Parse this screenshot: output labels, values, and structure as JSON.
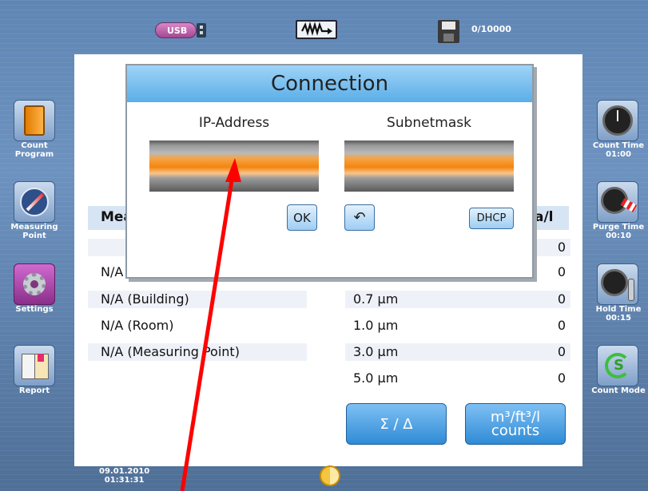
{
  "top_bar": {
    "usb_label": "USB",
    "memory_count": "0/10000"
  },
  "left_sidebar": [
    {
      "label_line1": "Count",
      "label_line2": "Program",
      "icon": "book-icon"
    },
    {
      "label_line1": "Measuring",
      "label_line2": "Point",
      "icon": "compass-icon"
    },
    {
      "label_line1": "Settings",
      "label_line2": "",
      "icon": "gear-icon"
    },
    {
      "label_line1": "Report",
      "label_line2": "",
      "icon": "report-icon"
    }
  ],
  "right_sidebar": [
    {
      "label": "Count Time",
      "value": "01:00",
      "icon": "clock-icon"
    },
    {
      "label": "Purge Time",
      "value": "00:10",
      "icon": "windsock-clock-icon"
    },
    {
      "label": "Hold Time",
      "value": "00:15",
      "icon": "thermometer-clock-icon"
    },
    {
      "label": "Count Mode",
      "value": "",
      "icon": "cycle-s-icon"
    }
  ],
  "main_table": {
    "header_left": "Mea",
    "header_right": "a/l",
    "location_rows": [
      "N/A",
      "N/A (Building)",
      "N/A (Room)",
      "N/A (Measuring Point)"
    ],
    "size_rows": [
      {
        "size": "",
        "count": "0"
      },
      {
        "size": "",
        "count": "0"
      },
      {
        "size": "0.7 µm",
        "count": "0"
      },
      {
        "size": "1.0 µm",
        "count": "0"
      },
      {
        "size": "3.0 µm",
        "count": "0"
      },
      {
        "size": "5.0 µm",
        "count": "0"
      }
    ],
    "ok_label": "OK"
  },
  "buttons": {
    "sum_delta": "Σ / Δ",
    "units_line1": "m³/ft³/l",
    "units_line2": "counts"
  },
  "dialog": {
    "title": "Connection",
    "ip_label": "IP-Address",
    "subnet_label": "Subnetmask",
    "ip_value": "",
    "subnet_value": "",
    "ok_label": "OK",
    "back_symbol": "↶",
    "dhcp_label": "DHCP"
  },
  "status_bar": {
    "date": "09.01.2010",
    "time": "01:31:31"
  },
  "colors": {
    "background": "#6d92bf",
    "dialog_title": "#5aaee8",
    "field_orange": "#f1860e",
    "annotation_arrow": "#ff0000"
  }
}
